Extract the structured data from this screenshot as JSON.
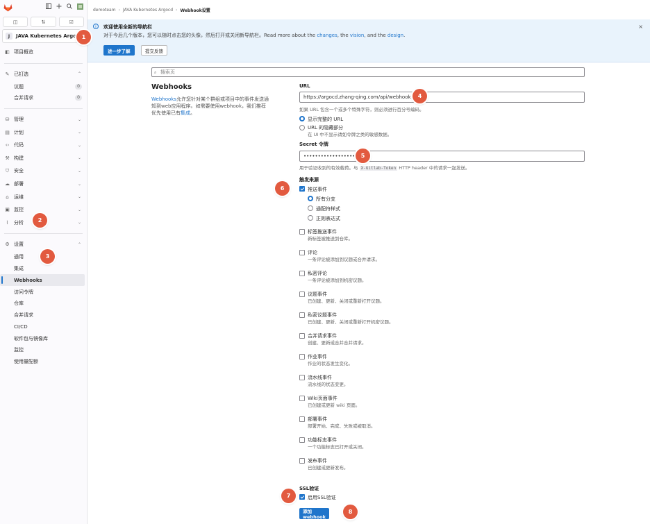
{
  "sidebar": {
    "project_initial": "J",
    "project_name": "JAVA Kubernetes Argocd",
    "items": [
      {
        "icon": "project-icon",
        "label": "项目概览"
      },
      {
        "icon": "pin-icon",
        "label": "已钉选"
      },
      {
        "icon": "manage-icon",
        "label": "管理"
      },
      {
        "icon": "plan-icon",
        "label": "计划"
      },
      {
        "icon": "code-icon",
        "label": "代码"
      },
      {
        "icon": "build-icon",
        "label": "构建"
      },
      {
        "icon": "shield-icon",
        "label": "安全"
      },
      {
        "icon": "deploy-icon",
        "label": "部署"
      },
      {
        "icon": "operate-icon",
        "label": "运维"
      },
      {
        "icon": "monitor-icon",
        "label": "监控"
      },
      {
        "icon": "analytics-icon",
        "label": "分析"
      },
      {
        "icon": "settings-icon",
        "label": "设置"
      }
    ],
    "pinned": [
      {
        "label": "议题",
        "count": "0"
      },
      {
        "label": "合并请求",
        "count": "0"
      }
    ],
    "settings_items": [
      "通用",
      "集成",
      "Webhooks",
      "访问令牌",
      "仓库",
      "合并请求",
      "CI/CD",
      "软件包与镜像库",
      "监控",
      "使用量配额"
    ]
  },
  "breadcrumb": [
    "demoteam",
    "JAVA Kubernetes Argocd",
    "Webhook设置"
  ],
  "alert": {
    "title": "欢迎使用全新的导航栏",
    "text": "对于今后几个版本，您可以随时点击您的头像，然后打开或关闭新导航栏。Read more about the ",
    "link1": "changes",
    "sep1": ", the ",
    "link2": "vision",
    "sep2": ", and the ",
    "link3": "design",
    "end": ".",
    "btn_primary": "进一步了解",
    "btn_secondary": "提交反馈",
    "close": "×"
  },
  "search": {
    "placeholder": "搜索页"
  },
  "webhooks": {
    "title": "Webhooks",
    "desc_link": "Webhooks",
    "desc": "允许您针对某个群组或项目中的事件发送通知到web应用程序。如需要使用webhook，我们推荐优先使用已有",
    "desc_link2": "集成",
    "desc_end": "。"
  },
  "form": {
    "url_label": "URL",
    "url_value": "https://argocd.zhang-qing.com/api/webhook",
    "url_help": "如果 URL 包含一个或多个特殊字符，则必须进行百分号编码。",
    "url_opt1": "显示完整的 URL",
    "url_opt2": "URL 的隐藏部分",
    "url_opt2_help": "在 UI 中不显示请如令牌之类的敏感数据。",
    "secret_label": "Secret 令牌",
    "secret_value": "••••••••••••••••••",
    "secret_help_a": "用于验证收到的有效载荷。与 ",
    "secret_help_code": "X-Gitlab-Token",
    "secret_help_b": " HTTP header 中的请求一起发送。",
    "trigger_label": "触发来源",
    "push": "推送事件",
    "push_opts": [
      "所有分支",
      "通配符样式",
      "正则表达式"
    ],
    "events": [
      {
        "t": "标签推送事件",
        "s": "新标签被推送到仓库。"
      },
      {
        "t": "评论",
        "s": "一条评论被添加到议题或合并请求。"
      },
      {
        "t": "私密评论",
        "s": "一条评论被添加到机密议题。"
      },
      {
        "t": "议题事件",
        "s": "已创建、更新、关闭或重新打开议题。"
      },
      {
        "t": "私密议题事件",
        "s": "已创建、更新、关闭或重新打开机密议题。"
      },
      {
        "t": "合并请求事件",
        "s": "创建、更新或合并合并请求。"
      },
      {
        "t": "作业事件",
        "s": "作业的状态发生变化。"
      },
      {
        "t": "流水线事件",
        "s": "流水线的状态变更。"
      },
      {
        "t": "Wiki页面事件",
        "s": "已创建或更新 wiki 页面。"
      },
      {
        "t": "部署事件",
        "s": "部署开始、完成、失败或被取消。"
      },
      {
        "t": "功能标志事件",
        "s": "一个功能标志已打开或关闭。"
      },
      {
        "t": "发布事件",
        "s": "已创建或更新发布。"
      }
    ],
    "ssl_label": "SSL验证",
    "ssl_opt": "启用SSL验证",
    "submit": "添加webhook"
  },
  "markers": [
    "1",
    "2",
    "3",
    "4",
    "5",
    "6",
    "7",
    "8"
  ],
  "colors": {
    "accent": "#1f75cb",
    "marker": "#e25a3f",
    "alert_bg": "#e9f3fc"
  }
}
